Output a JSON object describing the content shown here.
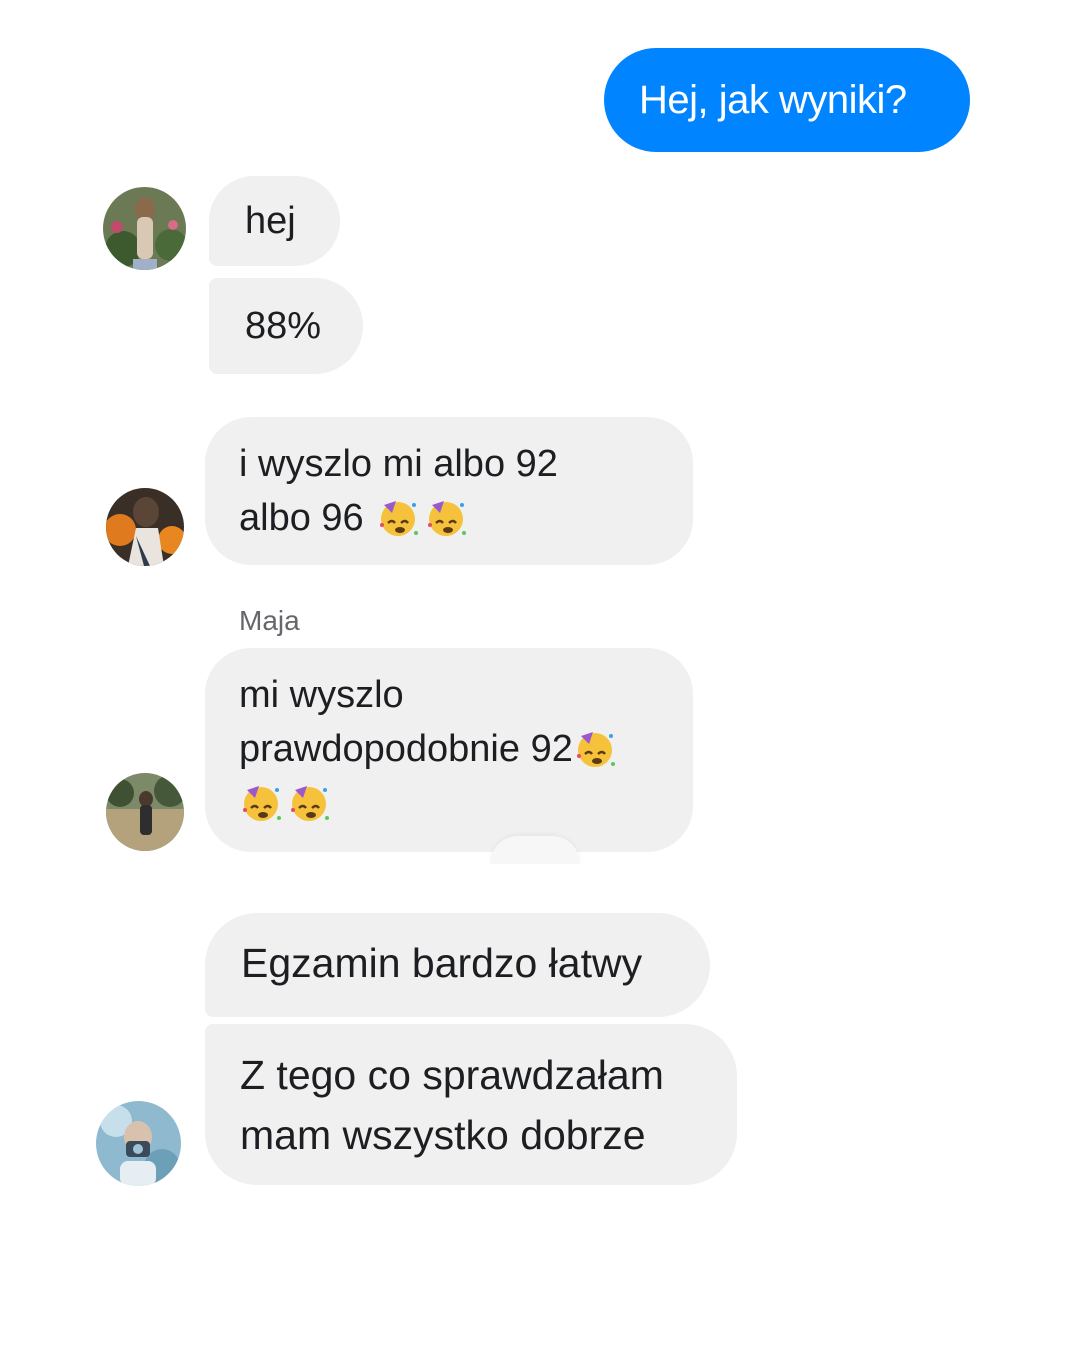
{
  "conversation": {
    "outgoing": [
      {
        "text": "Hej, jak wyniki?"
      }
    ],
    "groups": [
      {
        "avatar_icon": "avatar-photo-person-portrait",
        "messages": [
          {
            "lines": [
              "hej"
            ]
          },
          {
            "lines": [
              "88%"
            ]
          }
        ]
      },
      {
        "avatar_icon": "avatar-photo-person-outdoor",
        "messages": [
          {
            "lines": [
              "i wyszlo mi albo 92",
              "albo 96"
            ],
            "emoji": [
              "partying-face-emoji",
              "partying-face-emoji"
            ]
          }
        ]
      },
      {
        "sender_name": "Maja",
        "avatar_icon": "avatar-photo-person-field",
        "messages": [
          {
            "lines": [
              "mi wyszlo",
              "prawdopodobnie 92"
            ],
            "emoji": [
              "partying-face-emoji",
              "partying-face-emoji",
              "partying-face-emoji"
            ]
          }
        ]
      },
      {
        "avatar_icon": "avatar-photo-person-camera",
        "messages": [
          {
            "lines": [
              "Egzamin bardzo łatwy"
            ]
          },
          {
            "lines": [
              "Z tego co sprawdzałam",
              "mam wszystko dobrze"
            ]
          }
        ]
      }
    ]
  },
  "colors": {
    "outgoing_bubble": "#0084ff",
    "incoming_bubble": "#f0f0f0",
    "incoming_text": "#1c1e21",
    "sender_name": "#65676b"
  }
}
